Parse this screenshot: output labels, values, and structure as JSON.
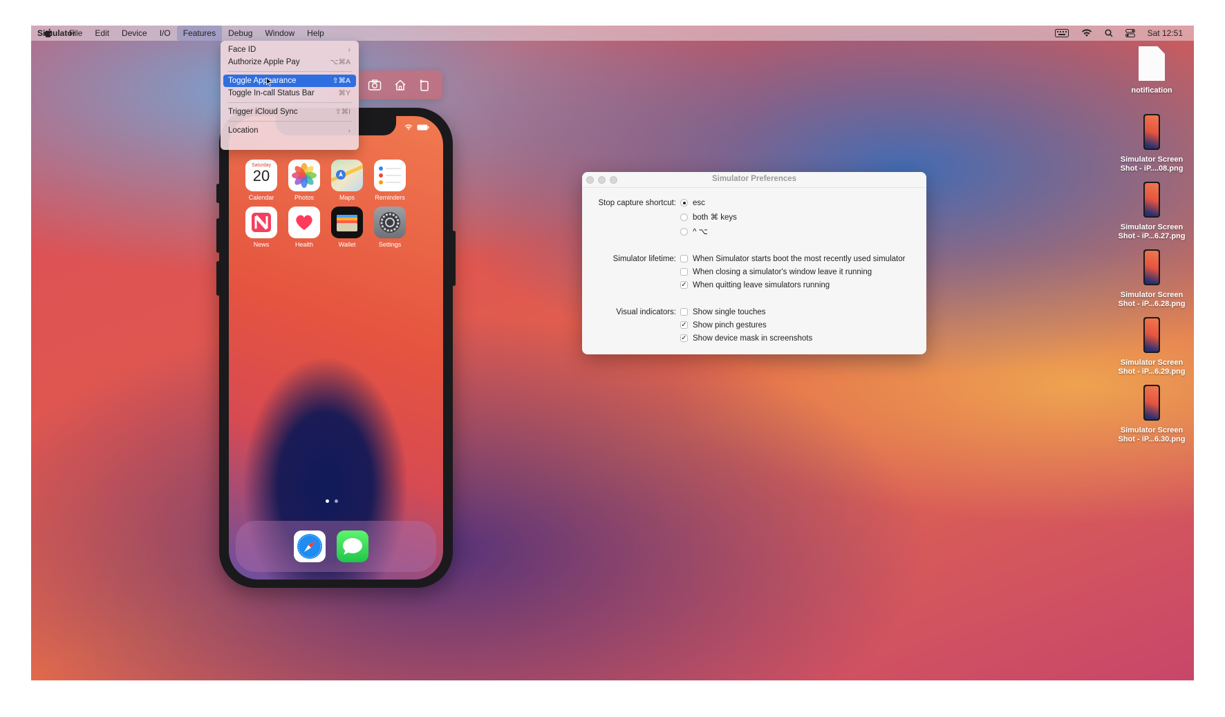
{
  "menubar": {
    "app": "Simulator",
    "items": [
      "File",
      "Edit",
      "Device",
      "I/O",
      "Features",
      "Debug",
      "Window",
      "Help"
    ],
    "active": "Features",
    "clock": "Sat 12:51"
  },
  "features_menu": {
    "items": [
      {
        "label": "Face ID",
        "shortcut": "›"
      },
      {
        "label": "Authorize Apple Pay",
        "shortcut": "⌥⌘A"
      },
      {
        "label": "Toggle Appearance",
        "shortcut": "⇧⌘A",
        "selected": true
      },
      {
        "label": "Toggle In-call Status Bar",
        "shortcut": "⌘Y"
      },
      {
        "label": "Trigger iCloud Sync",
        "shortcut": "⇧⌘I"
      },
      {
        "label": "Location",
        "shortcut": "›"
      }
    ]
  },
  "simulator_toolbar": {
    "icons": [
      "camera-icon",
      "home-icon",
      "rotate-icon"
    ]
  },
  "phone": {
    "calendar": {
      "day": "Saturday",
      "date": "20"
    },
    "apps": [
      "Calendar",
      "Photos",
      "Maps",
      "Reminders",
      "News",
      "Health",
      "Wallet",
      "Settings"
    ],
    "dock": [
      "Safari",
      "Messages"
    ],
    "page_count": 2,
    "current_page": 1
  },
  "prefs": {
    "title": "Simulator Preferences",
    "stop_capture": {
      "label": "Stop capture shortcut:",
      "options": [
        "esc",
        "both ⌘ keys",
        "^ ⌥"
      ],
      "selected": "esc"
    },
    "lifetime": {
      "label": "Simulator lifetime:",
      "options": [
        {
          "text": "When Simulator starts boot the most recently used simulator",
          "checked": false
        },
        {
          "text": "When closing a simulator's window leave it running",
          "checked": false
        },
        {
          "text": "When quitting leave simulators running",
          "checked": true
        }
      ]
    },
    "visual": {
      "label": "Visual indicators:",
      "options": [
        {
          "text": "Show single touches",
          "checked": false
        },
        {
          "text": "Show pinch gestures",
          "checked": true
        },
        {
          "text": "Show device mask in screenshots",
          "checked": true
        }
      ]
    }
  },
  "desktop": {
    "icons": [
      {
        "name": "notification",
        "line2": ""
      },
      {
        "name": "Simulator Screen",
        "line2": "Shot - iP....08.png"
      },
      {
        "name": "Simulator Screen",
        "line2": "Shot - iP...6.27.png"
      },
      {
        "name": "Simulator Screen",
        "line2": "Shot - iP...6.28.png"
      },
      {
        "name": "Simulator Screen",
        "line2": "Shot - iP...6.29.png"
      },
      {
        "name": "Simulator Screen",
        "line2": "Shot - iP...6.30.png"
      }
    ]
  }
}
